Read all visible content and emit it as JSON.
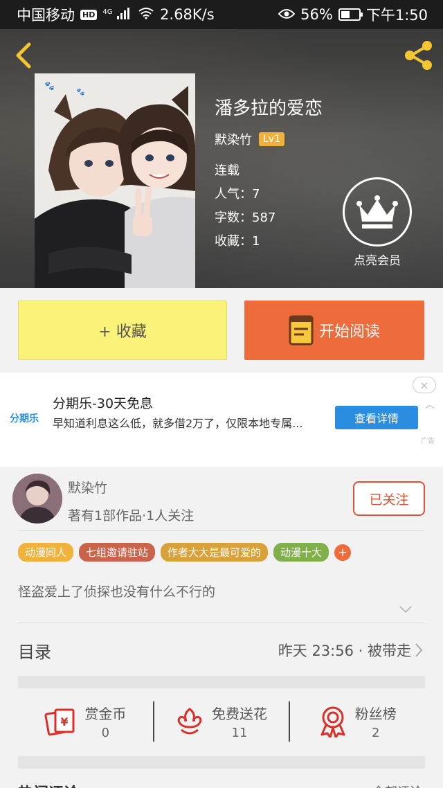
{
  "status_bar": {
    "carrier": "中国移动",
    "hd": "HD",
    "network": "4G",
    "speed": "2.68K/s",
    "battery": "56%",
    "battery_level": 0.56,
    "time": "下午1:50"
  },
  "book": {
    "title": "潘多拉的爱恋",
    "author": "默染竹",
    "author_level": "Lv1",
    "status": "连载",
    "popularity": "人气：7",
    "word_count": "字数：587",
    "favorites": "收藏：1",
    "vip_label": "点亮会员"
  },
  "actions": {
    "collect_label": "+ 收藏",
    "read_label": "开始阅读"
  },
  "ad": {
    "logo": "分期乐",
    "title": "分期乐-30天免息",
    "desc": "早知道利息这么低，就多借2万了，仅限本地专属...",
    "button": "查看详情",
    "tag": "广告",
    "close": "×"
  },
  "author_section": {
    "name": "默染竹",
    "stats": "著有1部作品·1人关注",
    "follow_label": "已关注",
    "tags": [
      {
        "label": "动漫同人",
        "color": "#f0b23a"
      },
      {
        "label": "七组邀请驻站",
        "color": "#c9634a"
      },
      {
        "label": "作者大大是最可爱的",
        "color": "#d9a13a"
      },
      {
        "label": "动漫十大",
        "color": "#7fb04a"
      }
    ],
    "tag_plus": "+",
    "description": "怪盗爱上了侦探也没有什么不行的"
  },
  "catalog": {
    "title": "目录",
    "update": "昨天 23:56 · 被带走"
  },
  "stats": [
    {
      "label": "赏金币",
      "value": "0",
      "icon": "red-envelope-icon"
    },
    {
      "label": "免费送花",
      "value": "11",
      "icon": "flower-icon"
    },
    {
      "label": "粉丝榜",
      "value": "2",
      "icon": "medal-icon"
    }
  ],
  "hot_comments": {
    "title": "热门评论",
    "right": "全部评论"
  },
  "colors": {
    "collect_bg": "#fbf27a",
    "read_bg": "#ee6b3c",
    "follow": "#d9523a",
    "ad_blue": "#2b8de0",
    "badge_gold": "#f0b23a"
  }
}
